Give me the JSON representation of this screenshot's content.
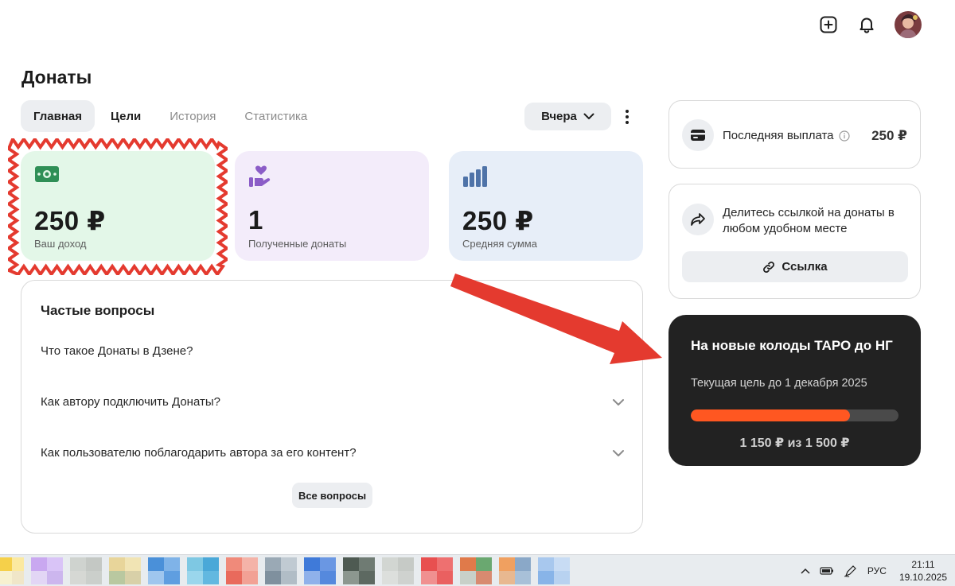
{
  "header": {
    "add_icon": "plus-square-icon",
    "bell_icon": "bell-icon",
    "avatar": "user-avatar"
  },
  "page": {
    "title": "Донаты"
  },
  "tabs": [
    {
      "label": "Главная",
      "state": "active"
    },
    {
      "label": "Цели",
      "state": "normal"
    },
    {
      "label": "История",
      "state": "muted"
    },
    {
      "label": "Статистика",
      "state": "muted"
    }
  ],
  "period": {
    "label": "Вчера"
  },
  "stats": [
    {
      "icon": "money-icon",
      "value": "250 ₽",
      "label": "Ваш доход",
      "color": "#e3f7e8",
      "highlighted": true
    },
    {
      "icon": "hand-heart-icon",
      "value": "1",
      "label": "Полученные донаты",
      "color": "#f3ecfa"
    },
    {
      "icon": "bar-chart-icon",
      "value": "250 ₽",
      "label": "Средняя сумма",
      "color": "#e7eef8"
    }
  ],
  "faq": {
    "title": "Частые вопросы",
    "items": [
      "Что такое Донаты в Дзене?",
      "Как автору подключить Донаты?",
      "Как пользователю поблагодарить автора за его контент?"
    ],
    "all_button": "Все вопросы"
  },
  "payout": {
    "label": "Последняя выплата",
    "amount": "250 ₽"
  },
  "share": {
    "text": "Делитесь ссылкой на донаты в любом удобном месте",
    "button": "Ссылка"
  },
  "goal": {
    "title": "На новые колоды ТАРО до НГ",
    "subtitle": "Текущая цель до 1 декабря 2025",
    "progress": 0.7667,
    "sum": "1 150 ₽ из 1 500 ₽",
    "fill_color": "#ff5721"
  },
  "taskbar": {
    "lang": "РУС",
    "time": "21:11",
    "date": "19.10.2025"
  },
  "colors": {
    "accent_orange": "#ff5721",
    "annotation_red": "#e43a2f"
  }
}
